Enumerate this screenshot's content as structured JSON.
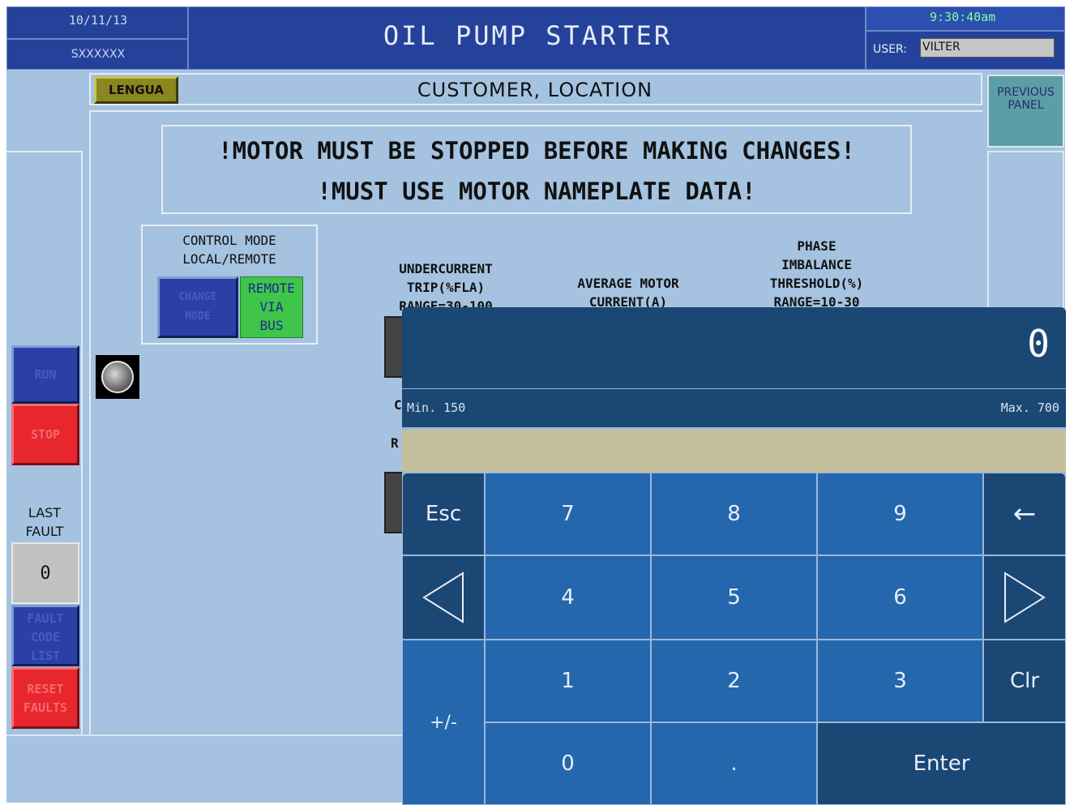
{
  "header": {
    "date": "10/11/13",
    "serial": "SXXXXXX",
    "title": "OIL PUMP STARTER",
    "time": "9:30:40am",
    "user_label": "USER:",
    "user_value": "VILTER"
  },
  "sub_header": {
    "language_button": "LENGUA",
    "customer": "CUSTOMER, LOCATION",
    "previous_panel": "PREVIOUS PANEL"
  },
  "warnings": {
    "line1": "!MOTOR MUST BE STOPPED BEFORE MAKING CHANGES!",
    "line2": "!MUST USE MOTOR NAMEPLATE DATA!"
  },
  "control_mode": {
    "title_line1": "CONTROL MODE",
    "title_line2": "LOCAL/REMOTE",
    "change_button_line1": "CHANGE",
    "change_button_line2": "MODE",
    "status_line1": "REMOTE",
    "status_line2": "VIA",
    "status_line3": "BUS"
  },
  "params": {
    "undercurrent_line1": "UNDERCURRENT",
    "undercurrent_line2": "TRIP(%FLA)",
    "undercurrent_line3": "RANGE=30-100",
    "avg_current_line1": "AVERAGE MOTOR",
    "avg_current_line2": "CURRENT(A)",
    "phase_line1": "PHASE",
    "phase_line2": "IMBALANCE",
    "phase_line3": "THRESHOLD(%)",
    "phase_line4": "RANGE=10-30",
    "partial_c": "C",
    "partial_r": "R"
  },
  "left_panel": {
    "run": "RUN",
    "stop": "STOP",
    "last_fault_line1": "LAST",
    "last_fault_line2": "FAULT",
    "last_fault_value": "0",
    "fault_code_line1": "FAULT",
    "fault_code_line2": "CODE",
    "fault_code_line3": "LIST",
    "reset_line1": "RESET",
    "reset_line2": "FAULTS"
  },
  "keypad": {
    "display_value": "0",
    "min_label": "Min. 150",
    "max_label": "Max. 700",
    "keys": {
      "esc": "Esc",
      "seven": "7",
      "eight": "8",
      "nine": "9",
      "backspace": "←",
      "four": "4",
      "five": "5",
      "six": "6",
      "one": "1",
      "two": "2",
      "three": "3",
      "clr": "Clr",
      "plus_minus": "+/-",
      "zero": "0",
      "dot": ".",
      "enter": "Enter"
    }
  },
  "colors": {
    "header_blue": "#25429a",
    "panel_bg": "#a5c3e0",
    "run_blue": "#2c3fa6",
    "stop_red": "#e8262e",
    "remote_green": "#3fc54a",
    "keypad_dark": "#1b4775",
    "keypad_key": "#2467ad",
    "lengua_olive": "#8a8720"
  }
}
